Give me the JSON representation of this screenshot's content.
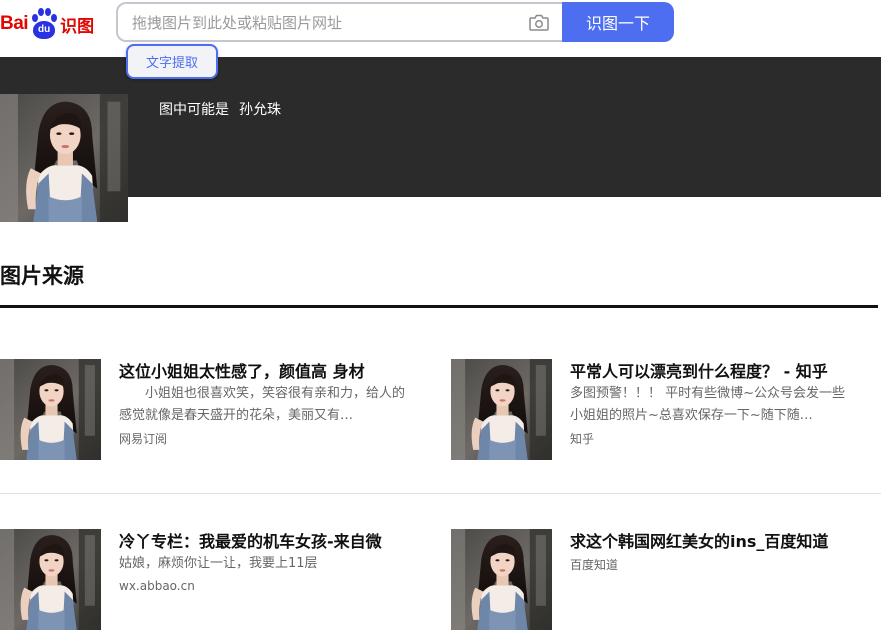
{
  "logo": {
    "bai": "Bai",
    "du": "du",
    "shitu": "识图"
  },
  "search": {
    "placeholder": "拖拽图片到此处或粘贴图片网址",
    "button_label": "识图一下",
    "camera_icon": "camera-icon"
  },
  "ocr_button_label": "文字提取",
  "result": {
    "label": "图中可能是",
    "name": "孙允珠"
  },
  "section_title": "图片来源",
  "sources": [
    {
      "title": "这位小姐姐太性感了，颜值高 身材",
      "description": "　　小姐姐也很喜欢笑，笑容很有亲和力，给人的感觉就像是春天盛开的花朵，美丽又有…",
      "source": "网易订阅"
    },
    {
      "title": "平常人可以漂亮到什么程度？ - 知乎",
      "description": "多图预警！！！ 平时有些微博~公众号会发一些小姐姐的照片~总喜欢保存一下~随下随…",
      "source": "知乎"
    },
    {
      "title": "冷丫专栏：我最爱的机车女孩-来自微",
      "description": "姑娘，麻烦你让一让，我要上11层",
      "source": "wx.abbao.cn"
    },
    {
      "title": "求这个韩国网红美女的ins_百度知道",
      "description": "",
      "source": "百度知道"
    }
  ],
  "colors": {
    "brand_blue": "#4e6ef2",
    "brand_red": "#e10602",
    "band_bg": "#2b2b2b"
  }
}
